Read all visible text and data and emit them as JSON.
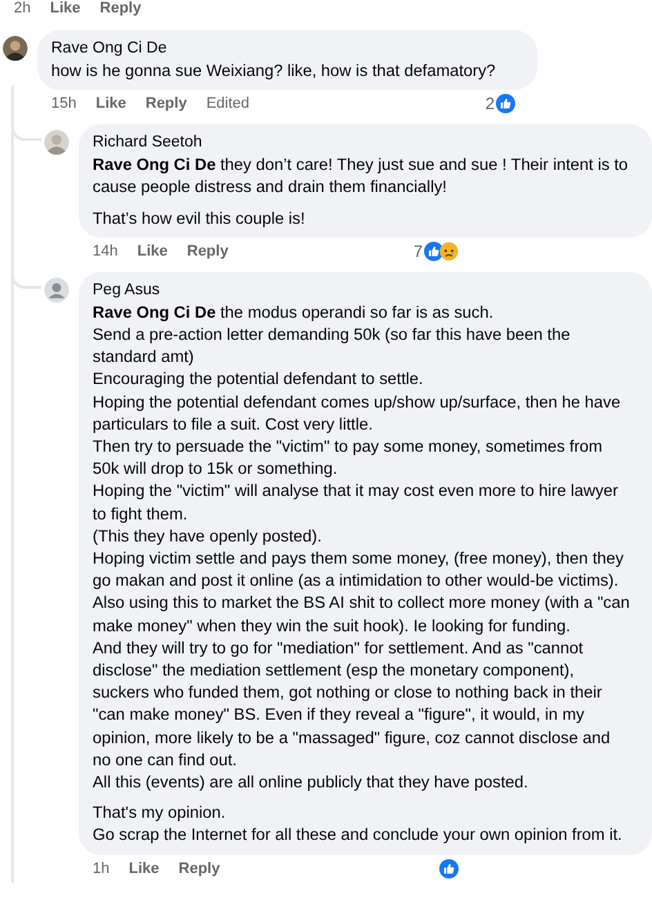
{
  "previous_actions": {
    "time": "2h",
    "like": "Like",
    "reply": "Reply"
  },
  "comments": [
    {
      "kind": "top",
      "photo_avatar": true,
      "author": "Rave Ong Ci De",
      "paragraphs": [
        [
          "how is he gonna sue Weixiang? like, how is that defamatory?"
        ]
      ],
      "time": "15h",
      "like": "Like",
      "reply": "Reply",
      "edited": "Edited",
      "reaction_count": "2",
      "like_reaction": true,
      "sad_reaction": false
    },
    {
      "kind": "reply",
      "photo_avatar": true,
      "author": "Richard Seetoh",
      "paragraphs": [
        [
          "**Rave Ong Ci De** they don’t care! They just sue and sue ! Their intent is to cause people distress and drain them financially!"
        ],
        [
          "That’s how evil this couple is!"
        ]
      ],
      "time": "14h",
      "like": "Like",
      "reply": "Reply",
      "reaction_count": "7",
      "like_reaction": true,
      "sad_reaction": true
    },
    {
      "kind": "reply",
      "photo_avatar": false,
      "author": "Peg Asus",
      "paragraphs": [
        [
          "**Rave Ong Ci De** the modus operandi so far is as such.",
          "Send a pre-action letter demanding 50k (so far this have been the standard amt)",
          "Encouraging the potential defendant to settle.",
          "Hoping the potential defendant comes up/show up/surface, then he have particulars to file a suit. Cost very little.",
          "Then try to persuade the \"victim\" to pay some money, sometimes from 50k will drop to 15k or something.",
          "Hoping the \"victim\" will analyse that it may cost even more to hire lawyer to fight them.",
          "(This they have openly posted).",
          "Hoping victim settle and pays them some money, (free money), then they go makan and post it online (as a intimidation to other would-be victims).",
          "Also using this to market the BS AI shit to collect more money (with a \"can make money\" when they win the suit hook). Ie looking for funding.",
          "And they will try to go for \"mediation\" for settlement. And as \"cannot disclose\" the mediation settlement (esp the monetary component), suckers who funded them, got nothing or close to nothing back in their \"can make money\" BS. Even if they reveal a \"figure\", it would, in my opinion, more likely to be a \"massaged\" figure, coz cannot disclose and no one can find out.",
          "All this (events) are all online publicly that they have posted."
        ],
        [
          "That's my opinion.",
          "Go scrap the Internet for all these and conclude your own opinion from it."
        ]
      ],
      "time": "1h",
      "like": "Like",
      "reply": "Reply",
      "like_reaction": true,
      "sad_reaction": false
    }
  ]
}
